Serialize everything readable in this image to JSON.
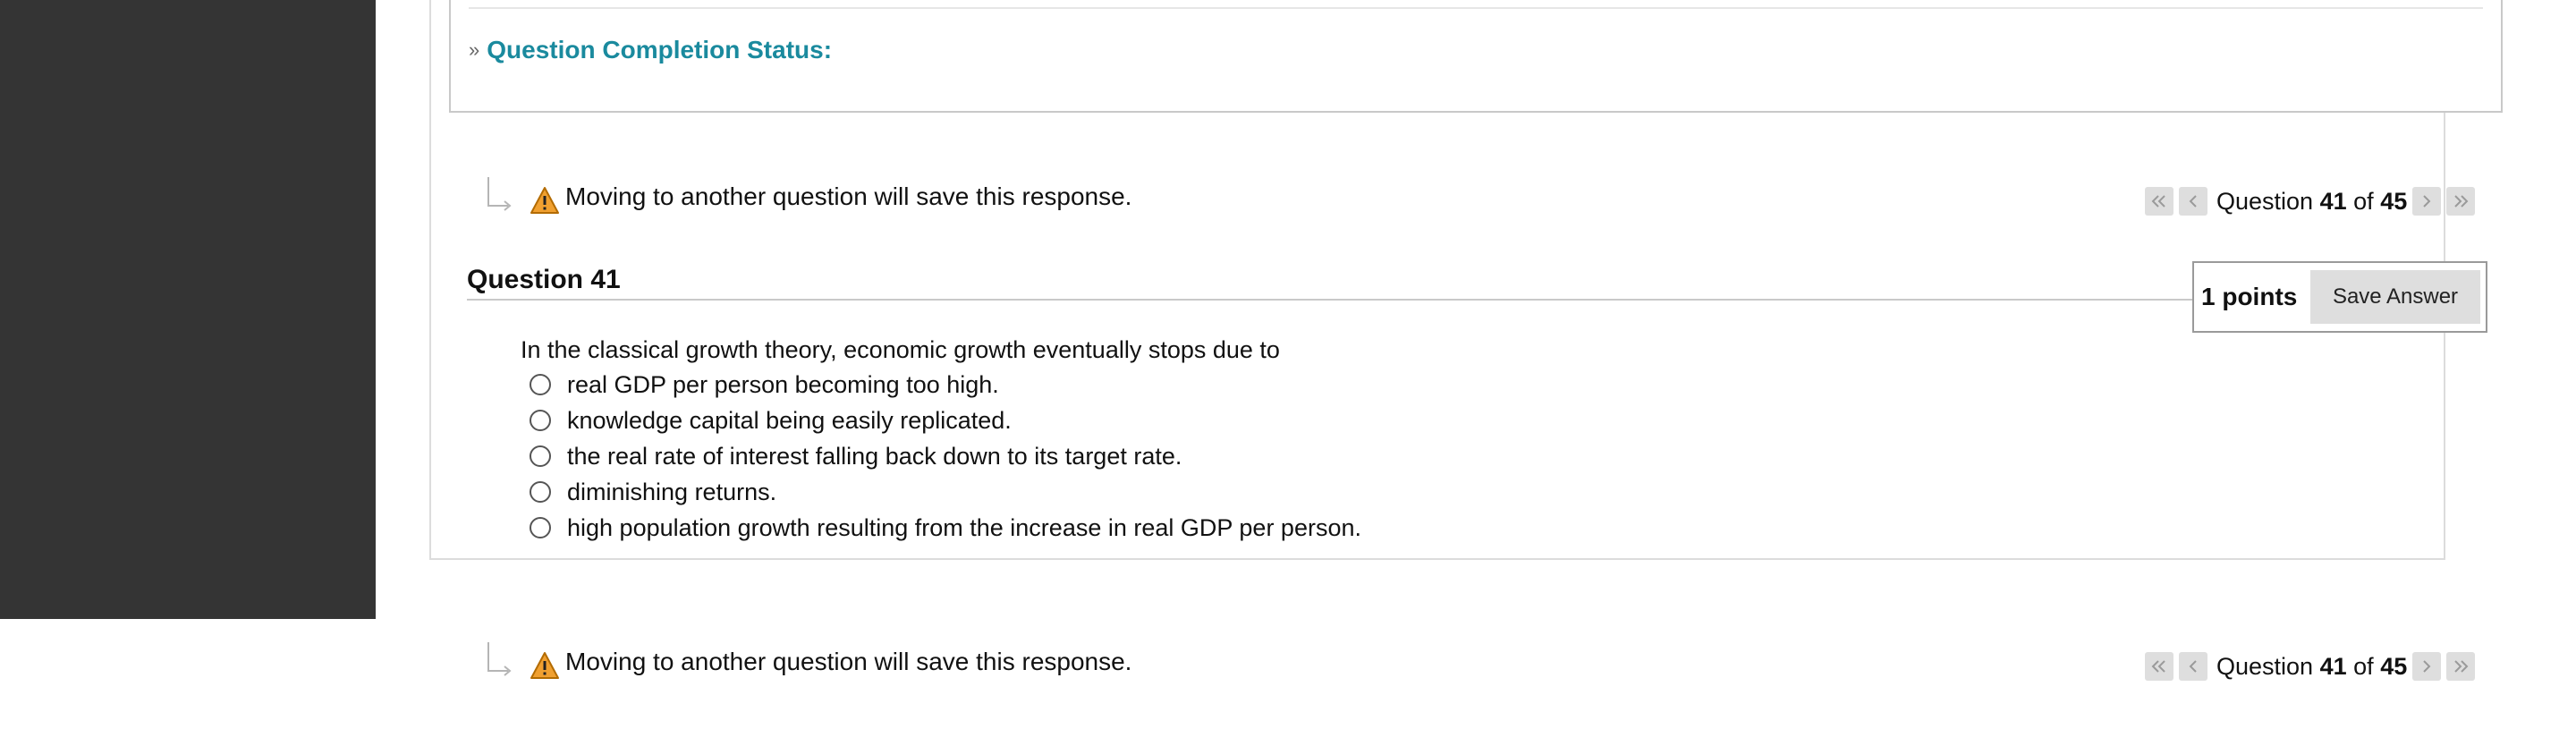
{
  "status_section": {
    "toggle_label": "Question Completion Status:",
    "icon": "double-chevron-down-icon"
  },
  "top_nav": {
    "notice": "Moving to another question will save this response.",
    "pager": {
      "prefix": "Question",
      "current": "41",
      "of": "of",
      "total": "45"
    }
  },
  "question": {
    "title": "Question 41",
    "points": "1 points",
    "save_label": "Save Answer",
    "prompt": "In the classical growth theory, economic growth eventually stops due to",
    "choices": [
      "real GDP per person becoming too high.",
      "knowledge capital being easily replicated.",
      "the real rate of interest falling back down to its target rate.",
      "diminishing returns.",
      "high population growth resulting from the increase in real GDP per person."
    ]
  },
  "bottom_nav": {
    "notice": "Moving to another question will save this response.",
    "pager": {
      "prefix": "Question",
      "current": "41",
      "of": "of",
      "total": "45"
    }
  },
  "colors": {
    "left_rail": "#343434",
    "status_link": "#1a8a9e",
    "pager_button": "#dedede",
    "warning_fill": "#f0a030"
  }
}
